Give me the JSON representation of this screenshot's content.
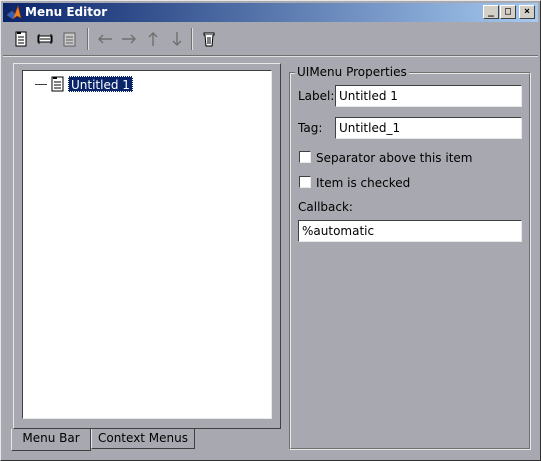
{
  "window": {
    "title": "Menu Editor",
    "minimize": "_",
    "maximize": "□",
    "close": "×"
  },
  "toolbar": {
    "buttons": [
      {
        "icon": "new-menu-icon"
      },
      {
        "icon": "new-menu-item-icon"
      },
      {
        "icon": "new-context-menu-icon"
      },
      {
        "icon": "move-left-icon"
      },
      {
        "icon": "move-right-icon"
      },
      {
        "icon": "move-up-icon"
      },
      {
        "icon": "move-down-icon"
      },
      {
        "icon": "delete-icon"
      }
    ]
  },
  "tree": {
    "items": [
      {
        "label": "Untitled 1",
        "selected": true
      }
    ]
  },
  "tabs": [
    {
      "label": "Menu Bar",
      "active": true
    },
    {
      "label": "Context Menus",
      "active": false
    }
  ],
  "properties": {
    "group_title": "UIMenu Properties",
    "label_caption": "Label:",
    "label_value": "Untitled 1",
    "tag_caption": "Tag:",
    "tag_value": "Untitled_1",
    "separator_caption": "Separator above this item",
    "separator_checked": false,
    "checked_caption": "Item is checked",
    "checked_checked": false,
    "callback_caption": "Callback:",
    "callback_value": "%automatic"
  },
  "colors": {
    "titlebar_start": "#0a246a",
    "titlebar_end": "#a6caf0",
    "selection": "#0a246a",
    "background": "#a8a8b0"
  }
}
